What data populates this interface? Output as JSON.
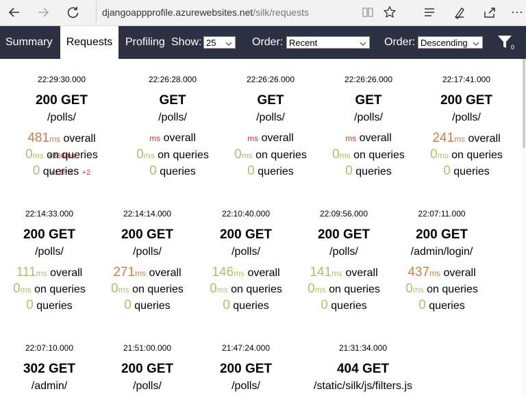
{
  "browser": {
    "url_host": "djangoappprofile.azurewebsites.net",
    "url_path": "/silk/requests"
  },
  "nav": {
    "summary": "Summary",
    "requests": "Requests",
    "profiling": "Profiling",
    "show_label": "Show:",
    "show_value": "25",
    "order_label": "Order:",
    "order_value": "Recent",
    "order2_label": "Order:",
    "order2_value": "Descending",
    "filter_count": "0"
  },
  "requests": [
    {
      "time": "22:29:30.000",
      "status": "200 GET",
      "path": "/polls/",
      "overall": "481",
      "overall_delta": "+366ms",
      "queries_time": "0",
      "queries_delta": "+12ms",
      "queries": "0",
      "queries_count_delta": "+2"
    },
    {
      "time": "22:26:28.000",
      "status": "GET",
      "path": "/polls/",
      "overall": "",
      "overall_delta": "",
      "queries_time": "0",
      "queries_delta": "",
      "queries": "0",
      "queries_count_delta": ""
    },
    {
      "time": "22:26:26.000",
      "status": "GET",
      "path": "/polls/",
      "overall": "",
      "overall_delta": "",
      "queries_time": "0",
      "queries_delta": "",
      "queries": "0",
      "queries_count_delta": ""
    },
    {
      "time": "22:26:26.000",
      "status": "GET",
      "path": "/polls/",
      "overall": "",
      "overall_delta": "",
      "queries_time": "0",
      "queries_delta": "",
      "queries": "0",
      "queries_count_delta": ""
    },
    {
      "time": "22:17:41.000",
      "status": "200 GET",
      "path": "/polls/",
      "overall": "241",
      "overall_delta": "",
      "queries_time": "0",
      "queries_delta": "",
      "queries": "0",
      "queries_count_delta": ""
    },
    {
      "time": "22:14:33.000",
      "status": "200 GET",
      "path": "/polls/",
      "overall": "111",
      "overall_delta": "",
      "queries_time": "0",
      "queries_delta": "",
      "queries": "0",
      "queries_count_delta": ""
    },
    {
      "time": "22:14:14.000",
      "status": "200 GET",
      "path": "/polls/",
      "overall": "271",
      "overall_delta": "",
      "queries_time": "0",
      "queries_delta": "",
      "queries": "0",
      "queries_count_delta": ""
    },
    {
      "time": "22:10:40.000",
      "status": "200 GET",
      "path": "/polls/",
      "overall": "146",
      "overall_delta": "",
      "queries_time": "0",
      "queries_delta": "",
      "queries": "0",
      "queries_count_delta": ""
    },
    {
      "time": "22:09:56.000",
      "status": "200 GET",
      "path": "/polls/",
      "overall": "141",
      "overall_delta": "",
      "queries_time": "0",
      "queries_delta": "",
      "queries": "0",
      "queries_count_delta": ""
    },
    {
      "time": "22:07:11.000",
      "status": "200 GET",
      "path": "/admin/login/",
      "overall": "437",
      "overall_delta": "",
      "queries_time": "0",
      "queries_delta": "",
      "queries": "0",
      "queries_count_delta": ""
    },
    {
      "time": "22:07:10.000",
      "status": "302 GET",
      "path": "/admin/"
    },
    {
      "time": "21:51:00.000",
      "status": "200 GET",
      "path": "/polls/"
    },
    {
      "time": "21:47:24.000",
      "status": "200 GET",
      "path": "/polls/"
    },
    {
      "time": "21:31:34.000",
      "status": "404 GET",
      "path": "/static/silk/js/filters.js"
    }
  ],
  "labels": {
    "ms": "ms",
    "overall": " overall",
    "on_queries": " on queries",
    "queries": " queries"
  },
  "colors": {
    "nav_bg": "#2e3142",
    "slow": "#c87f4b",
    "fast": "#a9c26b",
    "delta": "#c0392b"
  }
}
